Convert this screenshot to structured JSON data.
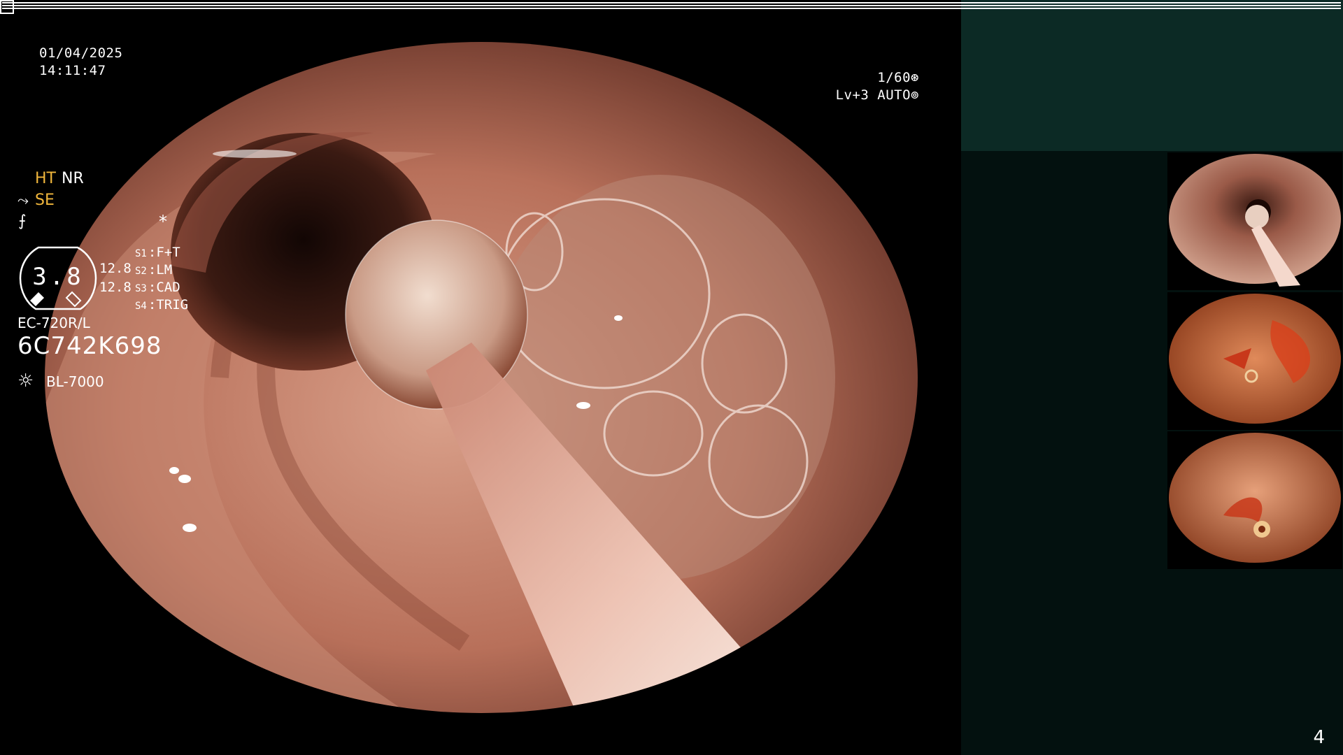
{
  "overlay": {
    "date": "01/04/2025",
    "time": "14:11:47",
    "shutter_speed": "1/60",
    "iris": "Lv+3 AUTO"
  },
  "panel": {
    "ht": "HT",
    "nr": "NR",
    "se": "SE",
    "asterisk": "*",
    "gauge_value": "3.8",
    "gauge_readout_1": "12.8",
    "gauge_readout_2": "12.8",
    "switches": [
      {
        "key": "S1",
        "value": "F+T"
      },
      {
        "key": "S2",
        "value": "LM"
      },
      {
        "key": "S3",
        "value": "CAD"
      },
      {
        "key": "S4",
        "value": "TRIG"
      }
    ],
    "scope_model": "EC-720R/L",
    "scope_serial": "6C742K698",
    "light_source": "BL-7000"
  },
  "page_number": "4",
  "icons": {
    "shutter": "aperture-icon",
    "iris": "iris-icon",
    "structure_enhance": "structure-enhance-icon",
    "sharpness": "sharpness-icon",
    "grid": "grid-icon",
    "light": "light-source-icon"
  },
  "colors": {
    "panel_background": "#03110f",
    "panel_top": "#0c2a25",
    "highlight_label": "#f0b63c"
  }
}
